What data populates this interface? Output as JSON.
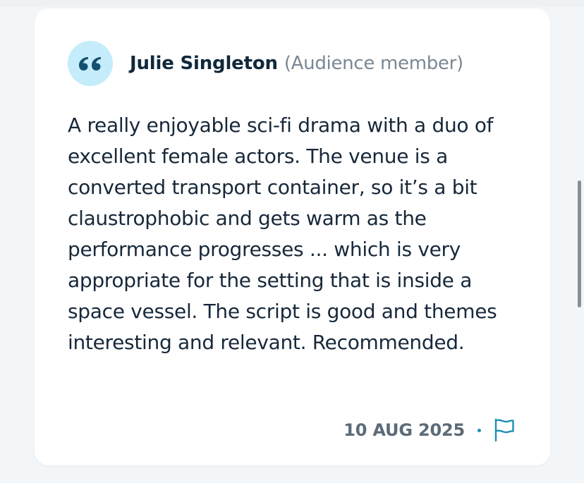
{
  "review": {
    "author_name": "Julie Singleton",
    "author_role": "(Audience member)",
    "body": "A really enjoyable sci-fi drama with a duo of excellent female actors. The venue is a converted transport container, so it’s a bit claustrophobic and gets warm as the performance progresses ... which is very appropriate for the setting that is inside a space vessel. The script is good and themes interesting and relevant. Recommended.",
    "date": "10 AUG 2025"
  },
  "icons": {
    "quote": "quote-icon",
    "flag": "flag-icon"
  },
  "colors": {
    "quote_badge_bg": "#c4ecfb",
    "quote_mark": "#13506e",
    "author": "#10283a",
    "role": "#7a8894",
    "body_text": "#17283a",
    "date": "#5c6b78",
    "accent": "#1c8fb4",
    "card_bg": "#ffffff",
    "page_bg": "#f3f6f8"
  }
}
